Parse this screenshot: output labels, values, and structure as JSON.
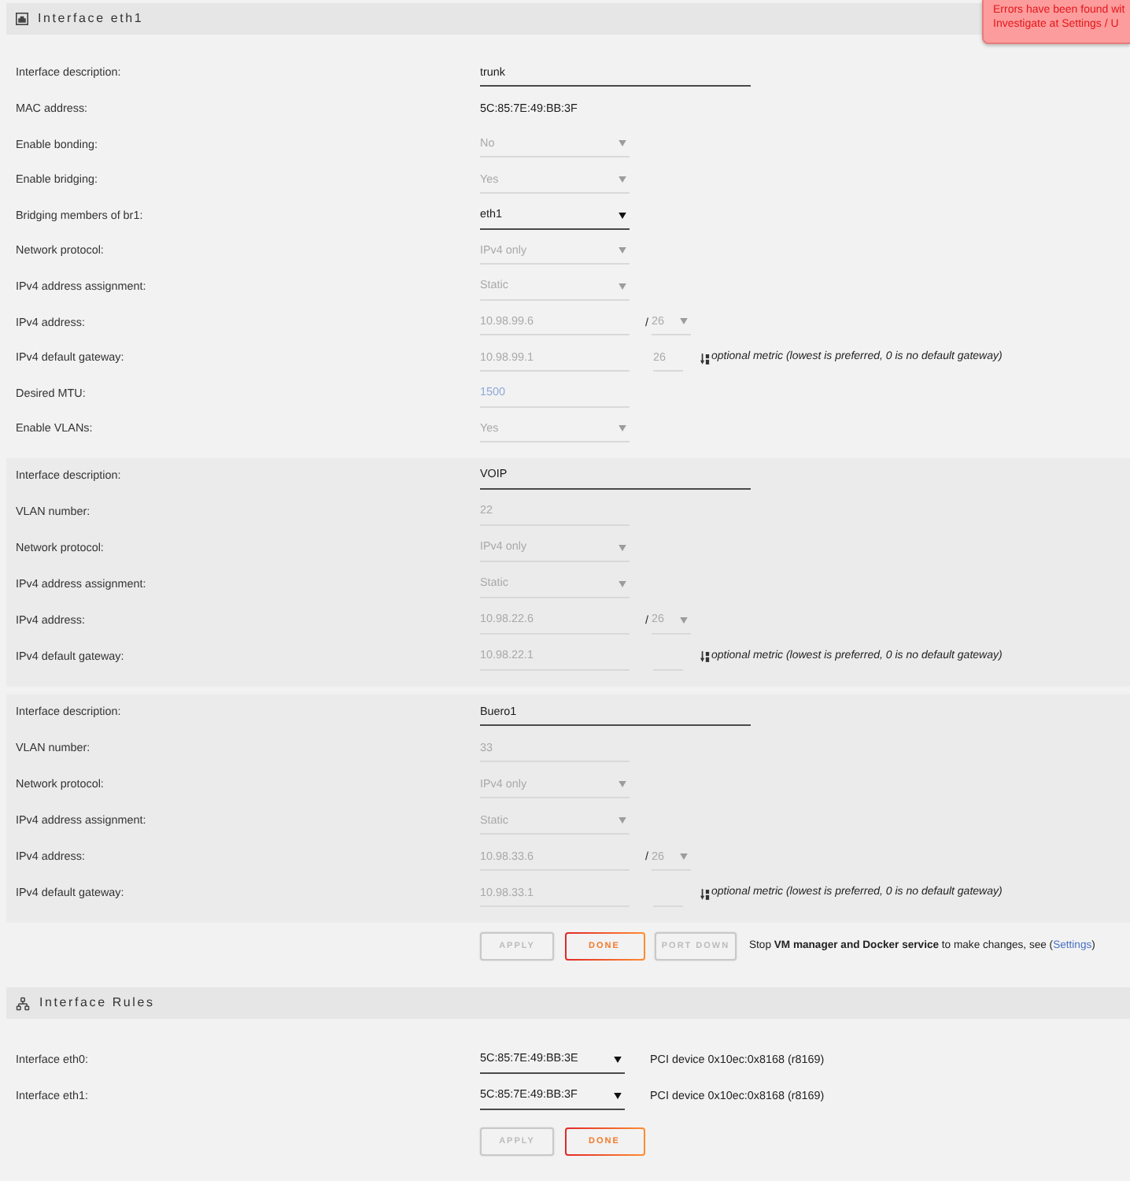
{
  "notification": {
    "lines": [
      "Errors have been found wit",
      "Investigate at Settings / U"
    ]
  },
  "interface": {
    "title": "Interface eth1",
    "rows": [
      {
        "kind": "text",
        "label": "Interface description:",
        "value": "trunk",
        "disabled": false
      },
      {
        "kind": "static",
        "label": "MAC address:",
        "value": "5C:85:7E:49:BB:3F"
      },
      {
        "kind": "select",
        "label": "Enable bonding:",
        "value": "No",
        "disabled": true
      },
      {
        "kind": "select",
        "label": "Enable bridging:",
        "value": "Yes",
        "disabled": true
      },
      {
        "kind": "select",
        "label": "Bridging members of br1:",
        "value": "eth1",
        "disabled": false
      },
      {
        "kind": "select",
        "label": "Network protocol:",
        "value": "IPv4 only",
        "disabled": true
      },
      {
        "kind": "select",
        "label": "IPv4 address assignment:",
        "value": "Static",
        "disabled": true
      },
      {
        "kind": "address",
        "label": "IPv4 address:",
        "value": "10.98.99.6",
        "separator": "/",
        "prefix": "26",
        "disabled": true
      },
      {
        "kind": "gateway",
        "label": "IPv4 default gateway:",
        "value": "10.98.99.1",
        "metric": "26",
        "hint": "optional metric (lowest is preferred, 0 is no default gateway)",
        "disabled": true
      },
      {
        "kind": "input",
        "label": "Desired MTU:",
        "placeholder": "1500",
        "disabled": true
      },
      {
        "kind": "select",
        "label": "Enable VLANs:",
        "value": "Yes",
        "disabled": true
      }
    ]
  },
  "vlans": [
    {
      "rows": [
        {
          "kind": "text",
          "label": "Interface description:",
          "value": "VOIP",
          "disabled": false
        },
        {
          "kind": "input",
          "label": "VLAN number:",
          "value": "22",
          "disabled": true
        },
        {
          "kind": "select",
          "label": "Network protocol:",
          "value": "IPv4 only",
          "disabled": true
        },
        {
          "kind": "select",
          "label": "IPv4 address assignment:",
          "value": "Static",
          "disabled": true
        },
        {
          "kind": "address",
          "label": "IPv4 address:",
          "value": "10.98.22.6",
          "separator": "/",
          "prefix": "26",
          "disabled": true
        },
        {
          "kind": "gateway",
          "label": "IPv4 default gateway:",
          "value": "10.98.22.1",
          "hint": "optional metric (lowest is preferred, 0 is no default gateway)",
          "disabled": true
        }
      ]
    },
    {
      "rows": [
        {
          "kind": "text",
          "label": "Interface description:",
          "value": "Buero1",
          "disabled": false
        },
        {
          "kind": "input",
          "label": "VLAN number:",
          "value": "33",
          "disabled": true
        },
        {
          "kind": "select",
          "label": "Network protocol:",
          "value": "IPv4 only",
          "disabled": true
        },
        {
          "kind": "select",
          "label": "IPv4 address assignment:",
          "value": "Static",
          "disabled": true
        },
        {
          "kind": "address",
          "label": "IPv4 address:",
          "value": "10.98.33.6",
          "separator": "/",
          "prefix": "26",
          "disabled": true
        },
        {
          "kind": "gateway",
          "label": "IPv4 default gateway:",
          "value": "10.98.33.1",
          "hint": "optional metric (lowest is preferred, 0 is no default gateway)",
          "disabled": true
        }
      ]
    }
  ],
  "actions": {
    "buttons": [
      {
        "label": "APPLY",
        "disabled": true
      },
      {
        "label": "DONE",
        "disabled": false
      },
      {
        "label": "PORT DOWN",
        "disabled": true
      }
    ],
    "note": "Stop **VM manager and Docker service** to make changes, see (",
    "link": "Settings",
    "note_end": ")"
  },
  "rules": {
    "title": "Interface Rules",
    "rows": [
      {
        "label": "Interface eth0:",
        "value": "5C:85:7E:49:BB:3E",
        "info": "PCI device 0x10ec:0x8168 (r8169)"
      },
      {
        "label": "Interface eth1:",
        "value": "5C:85:7E:49:BB:3F",
        "info": "PCI device 0x10ec:0x8168 (r8169)"
      }
    ],
    "buttons": [
      {
        "label": "APPLY",
        "disabled": true
      },
      {
        "label": "DONE",
        "disabled": false
      }
    ]
  }
}
